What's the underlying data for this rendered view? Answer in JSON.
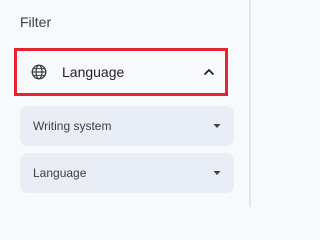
{
  "filter": {
    "title": "Filter"
  },
  "language_section": {
    "header_label": "Language",
    "icon": "globe-icon",
    "expanded": true,
    "highlight_color": "#e3252f"
  },
  "selects": [
    {
      "label": "Writing system",
      "icon": "dropdown-arrow-icon"
    },
    {
      "label": "Language",
      "icon": "dropdown-arrow-icon"
    }
  ]
}
